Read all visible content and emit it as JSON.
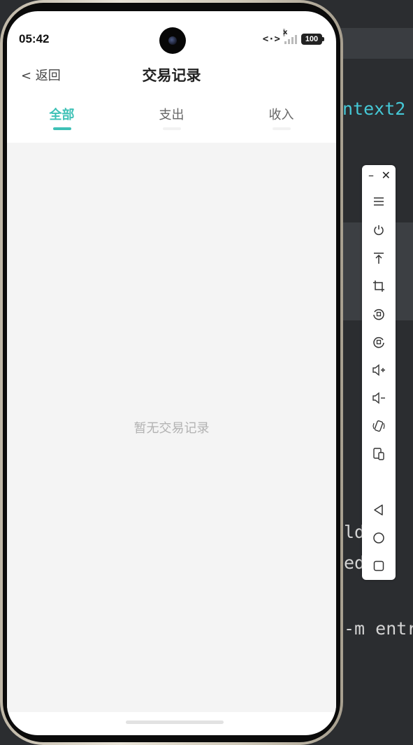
{
  "ide": {
    "code_line_top": "ntext2",
    "code_line_a": "ld\"fa",
    "code_line_b": "ed\"cc",
    "code_line_c": "-m entr"
  },
  "status_bar": {
    "time": "05:42",
    "net_label": "<·>",
    "signal_mark": "x",
    "battery": "100"
  },
  "header": {
    "back_label": "< 返回",
    "title": "交易记录"
  },
  "tabs": [
    {
      "label": "全部",
      "active": true
    },
    {
      "label": "支出",
      "active": false
    },
    {
      "label": "收入",
      "active": false
    }
  ],
  "content": {
    "empty_message": "暂无交易记录"
  },
  "emulator_toolbar": {
    "minimize_label": "–",
    "close_label": "✕",
    "buttons": [
      "menu-icon",
      "power-icon",
      "pin-top-icon",
      "crop-icon",
      "rotate-left-icon",
      "rotate-right-icon",
      "volume-up-icon",
      "volume-down-icon",
      "shake-icon",
      "multi-device-icon",
      "back-icon",
      "home-icon",
      "recents-icon"
    ]
  },
  "colors": {
    "accent": "#3ec1b6",
    "content_bg": "#f4f4f4",
    "ide_bg": "#2b2d30",
    "ide_cyan": "#45c8d6"
  }
}
